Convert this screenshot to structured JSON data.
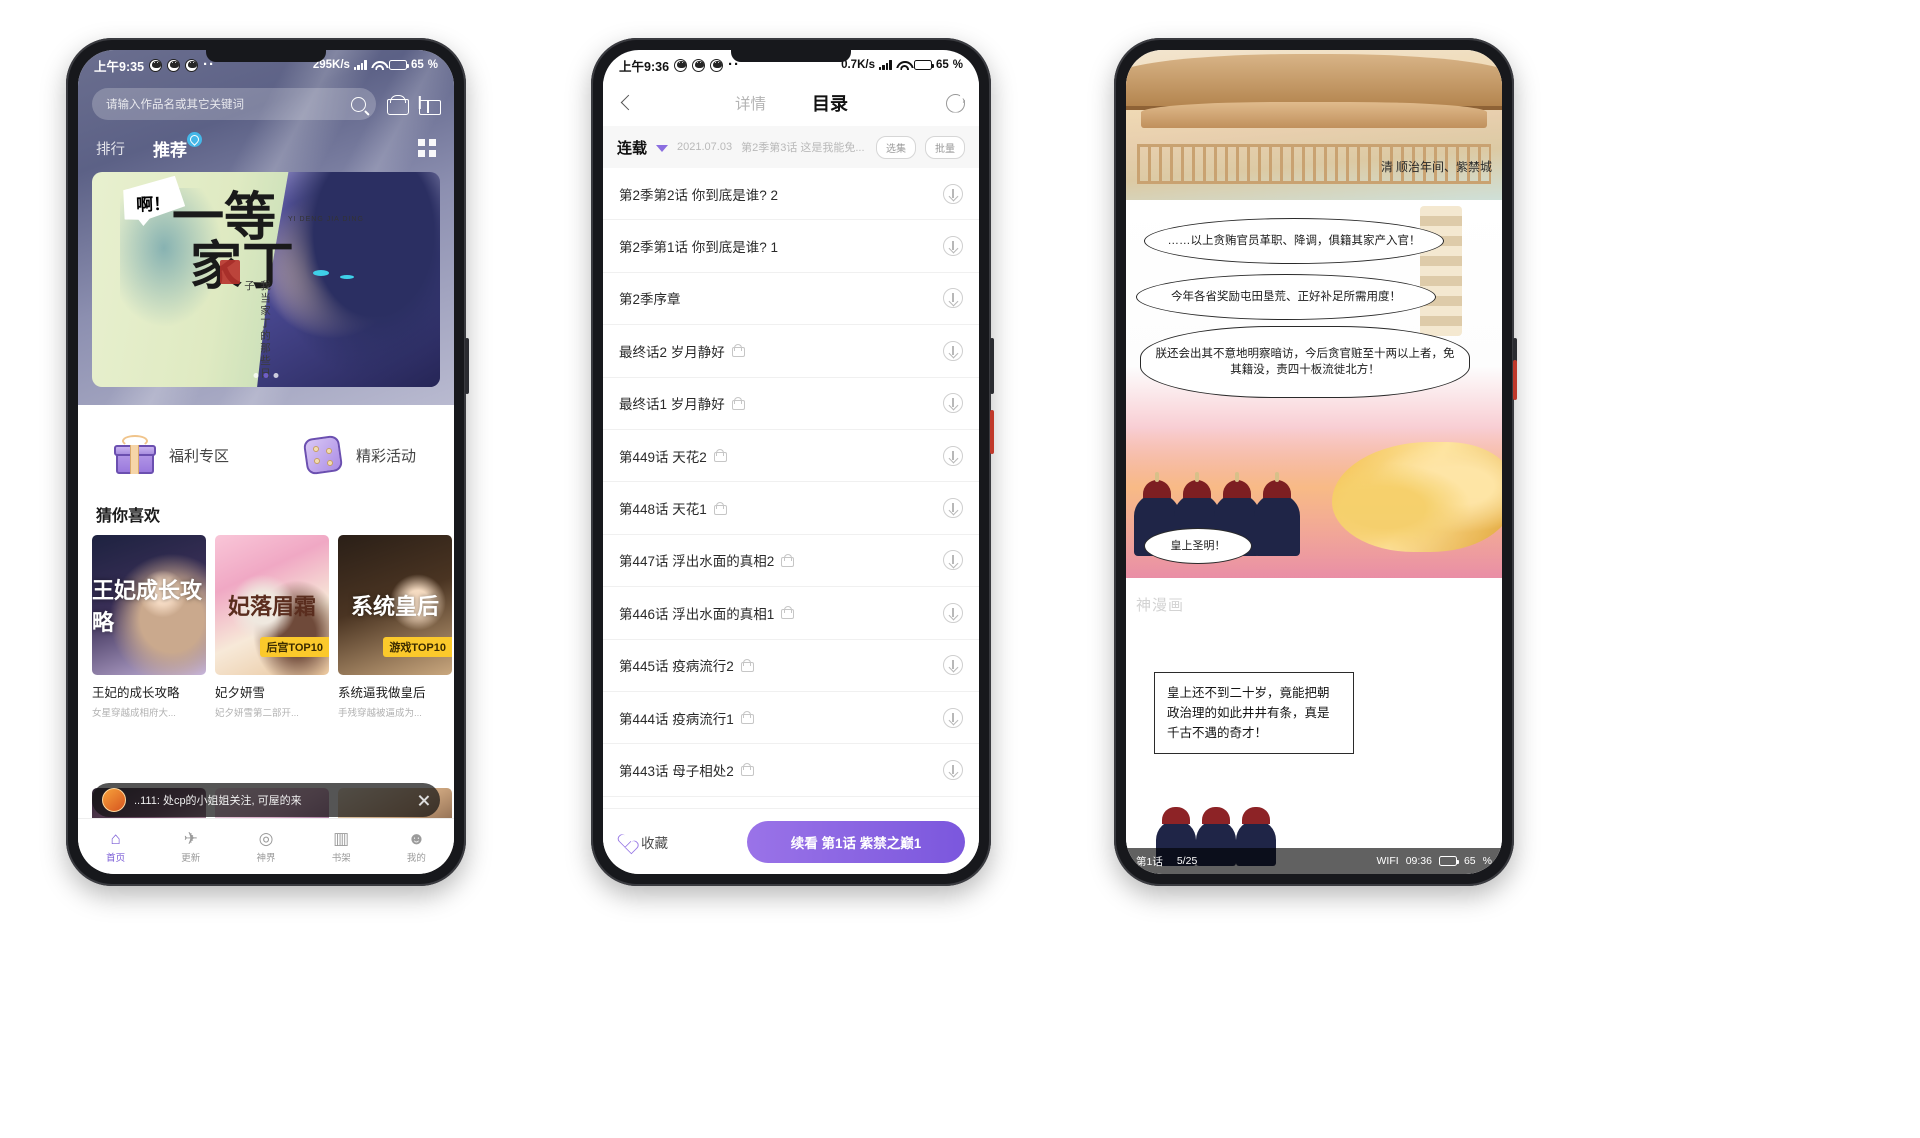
{
  "app": {
    "watermark": "神漫画"
  },
  "phone1": {
    "status": {
      "time": "上午9:35",
      "net_speed": "295K/s",
      "battery": "65",
      "battery_suffix": "%"
    },
    "search": {
      "placeholder": "请输入作品名或其它关键词",
      "search_icon": "search-icon",
      "shop_icon": "shop-icon",
      "gift_icon": "gift-icon"
    },
    "tabs": [
      {
        "label": "排行",
        "active": false
      },
      {
        "label": "推荐",
        "active": true
      }
    ],
    "grid_icon": "grid-icon",
    "banner": {
      "bubble": "啊！",
      "title_line1": "一等",
      "title_line2": "家丁",
      "pinyin": "YI DENG JIA DING",
      "sub": "我当家丁的那些日子",
      "dots": 3,
      "active_dot": 2
    },
    "quick": [
      {
        "label": "福利专区",
        "icon": "gift-box-icon"
      },
      {
        "label": "精彩活动",
        "icon": "dice-icon"
      }
    ],
    "section_title": "猜你喜欢",
    "cards": [
      {
        "title": "王妃的成长攻略",
        "desc": "女星穿越成相府大...",
        "cover_text": "王妃成长攻略",
        "badge": ""
      },
      {
        "title": "妃夕妍雪",
        "desc": "妃夕妍雪第二部开...",
        "cover_text": "妃落眉霜",
        "badge": "后宫TOP10"
      },
      {
        "title": "系统逼我做皇后",
        "desc": "手残穿越被逼成为...",
        "cover_text": "系统皇后",
        "badge": "游戏TOP10"
      }
    ],
    "mini_player": {
      "text": "..111: 处cp的小姐姐关注, 可屋的来",
      "close_icon": "close-icon",
      "avatar": "avatar"
    },
    "tabbar": [
      {
        "label": "首页",
        "glyph": "⌂",
        "active": true
      },
      {
        "label": "更新",
        "glyph": "✈",
        "active": false
      },
      {
        "label": "神界",
        "glyph": "◎",
        "active": false
      },
      {
        "label": "书架",
        "glyph": "▥",
        "active": false
      },
      {
        "label": "我的",
        "glyph": "☻",
        "active": false
      }
    ]
  },
  "phone2": {
    "status": {
      "time": "上午9:36",
      "net_speed": "0.7K/s",
      "battery": "65",
      "battery_suffix": "%"
    },
    "nav": {
      "back_icon": "back-icon",
      "tab_detail": "详情",
      "tab_catalog": "目录",
      "share_icon": "share-icon"
    },
    "filter": {
      "status": "连载",
      "caret_icon": "chevron-down-icon",
      "date": "2021.07.03",
      "latest": "第2季第3话 这是我能免...",
      "select_btn": "选集",
      "batch_btn": "批量"
    },
    "chapters": [
      {
        "name": "第2季第2话 你到底是谁? 2",
        "locked": false
      },
      {
        "name": "第2季第1话 你到底是谁? 1",
        "locked": false
      },
      {
        "name": "第2季序章",
        "locked": false
      },
      {
        "name": "最终话2 岁月静好",
        "locked": true
      },
      {
        "name": "最终话1 岁月静好",
        "locked": true
      },
      {
        "name": "第449话 天花2",
        "locked": true
      },
      {
        "name": "第448话 天花1",
        "locked": true
      },
      {
        "name": "第447话 浮出水面的真相2",
        "locked": true
      },
      {
        "name": "第446话 浮出水面的真相1",
        "locked": true
      },
      {
        "name": "第445话 疫病流行2",
        "locked": true
      },
      {
        "name": "第444话 疫病流行1",
        "locked": true
      },
      {
        "name": "第443话 母子相处2",
        "locked": true
      }
    ],
    "bottom": {
      "fav_label": "收藏",
      "fav_icon": "heart-icon",
      "continue_label": "续看 第1话 紫禁之巅1"
    }
  },
  "phone3": {
    "caption": "清 顺治年间、紫禁城",
    "bubbles": [
      "……以上贪贿官员革职、降调，俱籍其家产入官！",
      "今年各省奖励屯田垦荒、正好补足所需用度！",
      "朕还会出其不意地明察暗访，今后贪官赃至十两以上者，免其籍没，责四十板流徙北方！",
      "皇上圣明！"
    ],
    "panel_text": "皇上还不到二十岁，竟能把朝政治理的如此井井有条，真是千古不遇的奇才！",
    "reader_bar": {
      "chapter": "第1话",
      "pages": "5/25",
      "network": "WIFI",
      "time": "09:36",
      "battery": "65",
      "battery_suffix": "%"
    }
  },
  "colors": {
    "accent": "#7a5cd6",
    "badge_yellow": "#fbc92b",
    "lock_gray": "#999999"
  }
}
